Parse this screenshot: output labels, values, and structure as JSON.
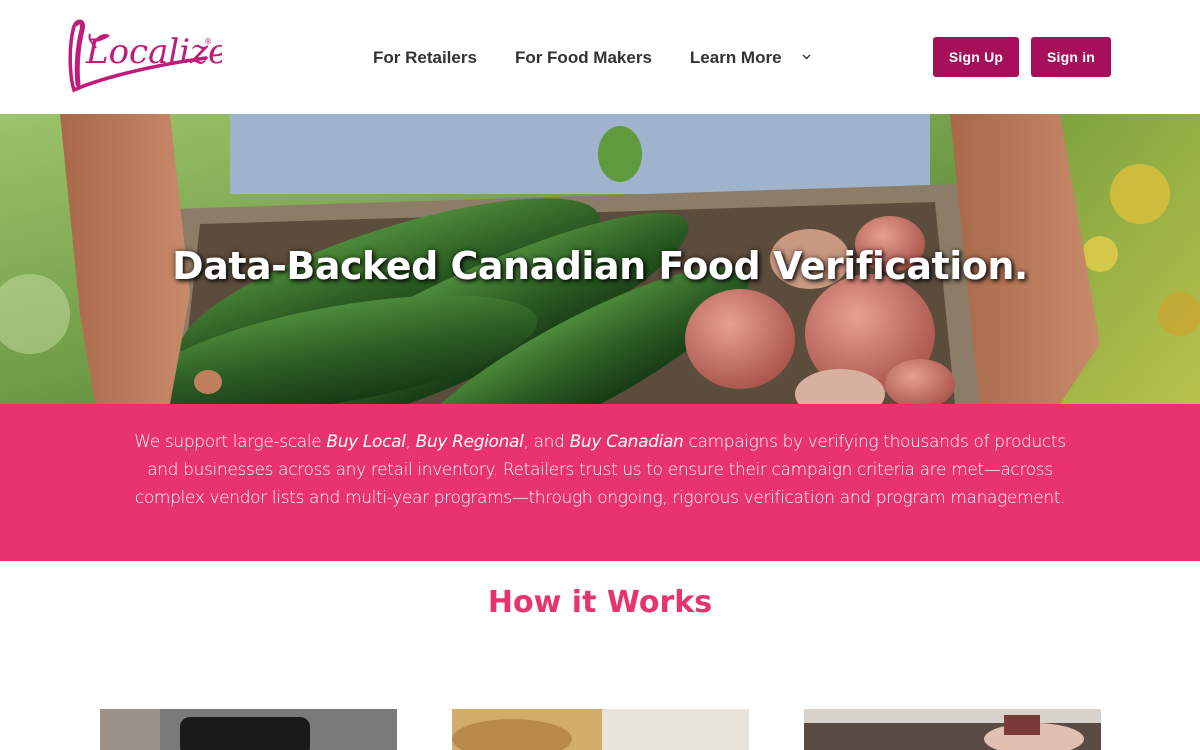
{
  "brand": {
    "logo_text": "Localize",
    "registered": "®",
    "accent": "#c01a7a",
    "band_color": "#e8336d",
    "button_color": "#a60f5a"
  },
  "nav": {
    "items": [
      {
        "label": "For Retailers"
      },
      {
        "label": "For Food Makers"
      },
      {
        "label": "Learn More",
        "icon": "chevron-down-icon"
      }
    ]
  },
  "auth": {
    "signup_label": "Sign Up",
    "signin_label": "Sign in"
  },
  "hero": {
    "title": "Data-Backed Canadian Food Verification."
  },
  "intro": {
    "part1": "We support large-scale ",
    "em1": "Buy Local",
    "sep1": ", ",
    "em2": "Buy Regional",
    "sep2": ", and ",
    "em3": "Buy Canadian",
    "part2": " campaigns by verifying thousands of products and businesses across any retail inventory. Retailers trust us to ensure their campaign criteria are met—across complex vendor lists and multi-year programs—through ongoing, rigorous verification and program management."
  },
  "how_it_works": {
    "title": "How it Works"
  }
}
